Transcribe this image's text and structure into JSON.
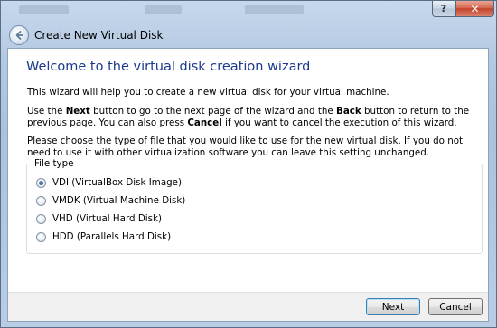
{
  "window": {
    "title": "Create New Virtual Disk",
    "help_glyph": "?",
    "close_glyph": "✕"
  },
  "wizard": {
    "heading": "Welcome to the virtual disk creation wizard",
    "intro": "This wizard will help you to create a new virtual disk for your virtual machine.",
    "nav_text": {
      "part1": "Use the ",
      "next_word": "Next",
      "part2": " button to go to the next page of the wizard and the ",
      "back_word": "Back",
      "part3": " button to return to the previous page. You can also press ",
      "cancel_word": "Cancel",
      "part4": " if you want to cancel the execution of this wizard."
    },
    "choose_text": "Please choose the type of file that you would like to use for the new virtual disk. If you do not need to use it with other virtualization software you can leave this setting unchanged."
  },
  "file_type": {
    "legend": "File type",
    "selected_index": 0,
    "options": [
      {
        "label": "VDI (VirtualBox Disk Image)"
      },
      {
        "label": "VMDK (Virtual Machine Disk)"
      },
      {
        "label": "VHD (Virtual Hard Disk)"
      },
      {
        "label": "HDD (Parallels Hard Disk)"
      }
    ]
  },
  "buttons": {
    "next": "Next",
    "cancel": "Cancel"
  },
  "colors": {
    "heading": "#1b3a8c",
    "frame": "#b4c9e2",
    "close": "#c2432b"
  },
  "icons": {
    "back": "back-arrow-icon",
    "help": "help-icon",
    "close": "close-icon"
  }
}
